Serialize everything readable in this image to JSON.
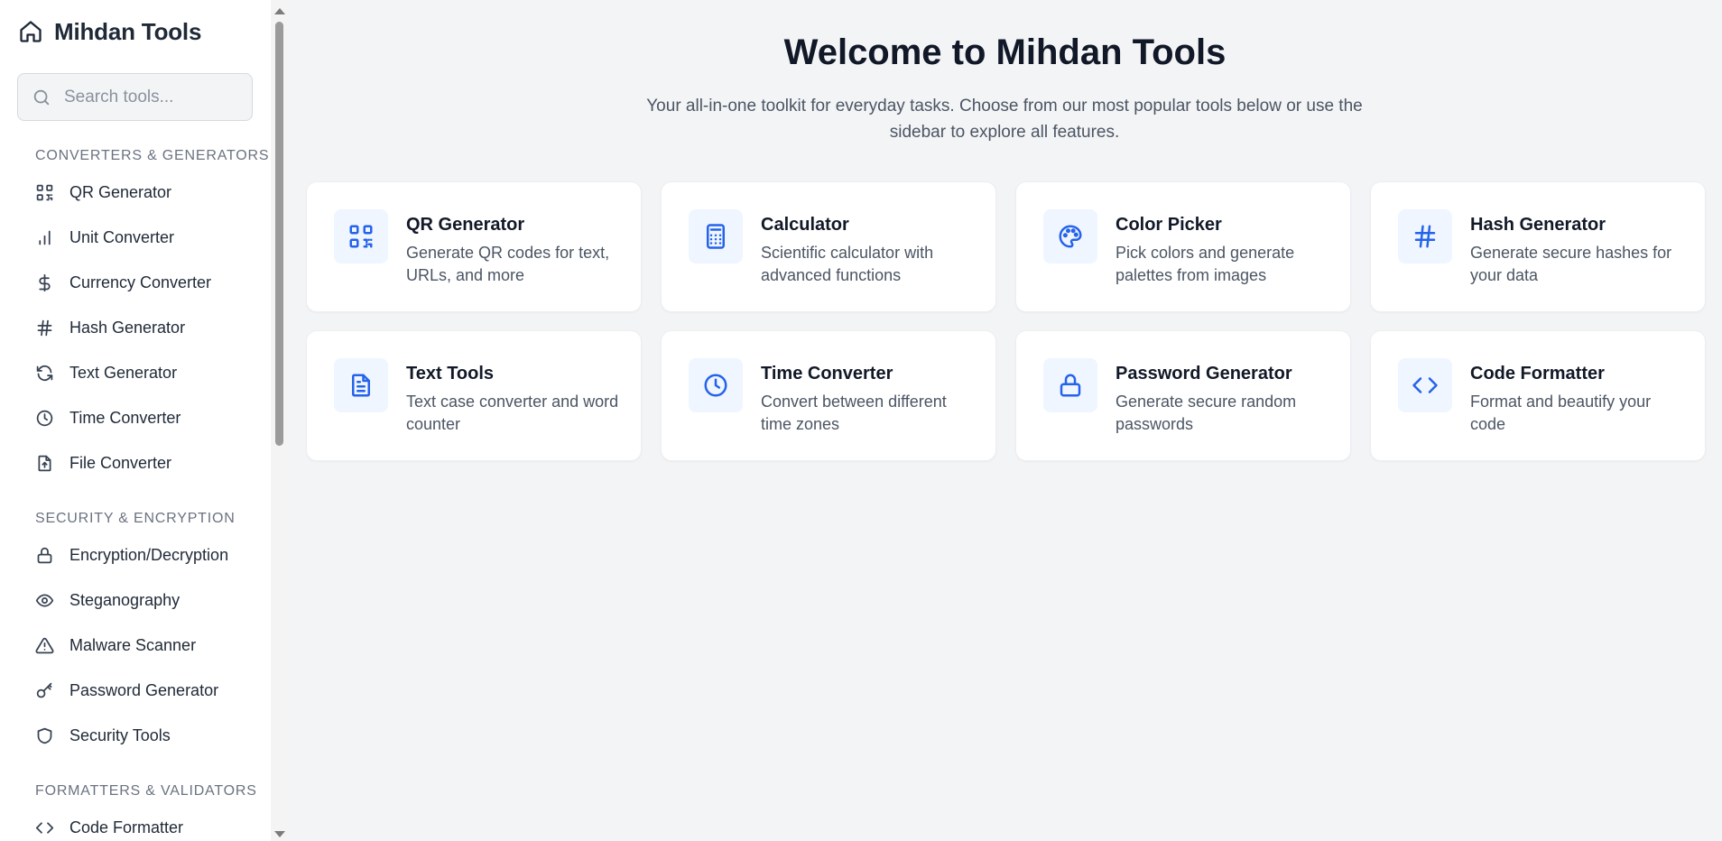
{
  "app": {
    "title": "Mihdan Tools"
  },
  "search": {
    "placeholder": "Search tools..."
  },
  "sidebar": {
    "sections": [
      {
        "title": "Converters & Generators",
        "items": [
          {
            "label": "QR Generator",
            "icon": "qr-code-icon"
          },
          {
            "label": "Unit Converter",
            "icon": "bar-chart-icon"
          },
          {
            "label": "Currency Converter",
            "icon": "dollar-icon"
          },
          {
            "label": "Hash Generator",
            "icon": "hash-icon"
          },
          {
            "label": "Text Generator",
            "icon": "refresh-icon"
          },
          {
            "label": "Time Converter",
            "icon": "clock-icon"
          },
          {
            "label": "File Converter",
            "icon": "file-upload-icon"
          }
        ]
      },
      {
        "title": "Security & Encryption",
        "items": [
          {
            "label": "Encryption/Decryption",
            "icon": "lock-icon"
          },
          {
            "label": "Steganography",
            "icon": "eye-icon"
          },
          {
            "label": "Malware Scanner",
            "icon": "warning-icon"
          },
          {
            "label": "Password Generator",
            "icon": "key-icon"
          },
          {
            "label": "Security Tools",
            "icon": "shield-icon"
          }
        ]
      },
      {
        "title": "Formatters & Validators",
        "items": [
          {
            "label": "Code Formatter",
            "icon": "code-icon"
          }
        ]
      }
    ]
  },
  "main": {
    "heading": "Welcome to Mihdan Tools",
    "subtitle": "Your all-in-one toolkit for everyday tasks. Choose from our most popular tools below or use the sidebar to explore all features.",
    "cards": [
      {
        "title": "QR Generator",
        "description": "Generate QR codes for text, URLs, and more",
        "icon": "qr-code-icon"
      },
      {
        "title": "Calculator",
        "description": "Scientific calculator with advanced functions",
        "icon": "calculator-icon"
      },
      {
        "title": "Color Picker",
        "description": "Pick colors and generate palettes from images",
        "icon": "palette-icon"
      },
      {
        "title": "Hash Generator",
        "description": "Generate secure hashes for your data",
        "icon": "hash-icon"
      },
      {
        "title": "Text Tools",
        "description": "Text case converter and word counter",
        "icon": "document-icon"
      },
      {
        "title": "Time Converter",
        "description": "Convert between different time zones",
        "icon": "clock-icon"
      },
      {
        "title": "Password Generator",
        "description": "Generate secure random passwords",
        "icon": "lock-icon"
      },
      {
        "title": "Code Formatter",
        "description": "Format and beautify your code",
        "icon": "code-icon"
      }
    ]
  },
  "colors": {
    "accent": "#2563eb",
    "icon_bg": "#eff6ff",
    "page_bg": "#f3f4f6",
    "sidebar_bg": "#ffffff"
  }
}
